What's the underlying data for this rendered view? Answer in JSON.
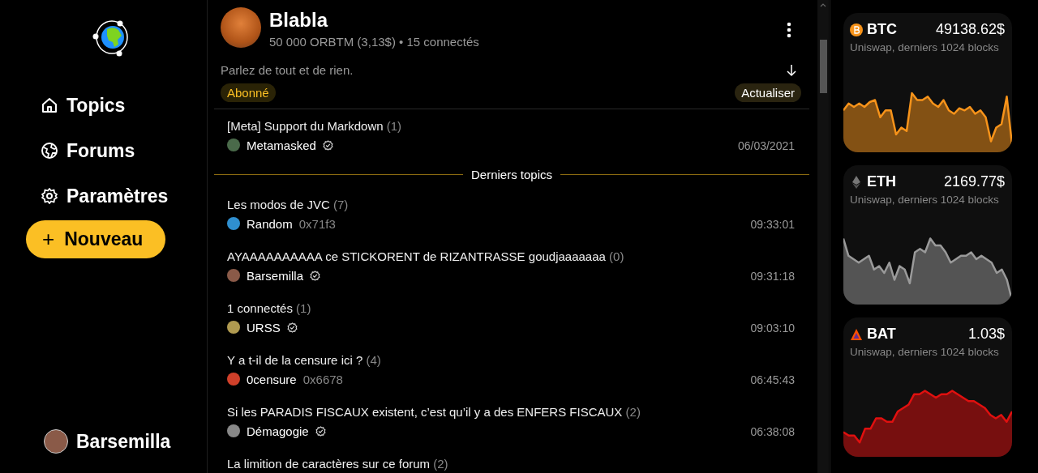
{
  "sidebar": {
    "nav": [
      {
        "label": "Topics"
      },
      {
        "label": "Forums"
      },
      {
        "label": "Paramètres"
      }
    ],
    "new_button_icon": "+",
    "new_button": "Nouveau",
    "user": {
      "name": "Barsemilla"
    }
  },
  "forum": {
    "name": "Blabla",
    "stats": "50 000 ORBTM (3,13$) • 15 connectés",
    "description": "Parlez de tout et de rien.",
    "subscribed_label": "Abonné",
    "refresh_label": "Actualiser"
  },
  "pinned": [
    {
      "title": "[Meta] Support du Markdown",
      "count": "(1)",
      "author": "Metamasked",
      "verified": true,
      "time": "06/03/2021"
    }
  ],
  "section_title": "Derniers topics",
  "topics": [
    {
      "title": "Les modos de JVC",
      "count": "(7)",
      "author": "Random",
      "address": "0x71f3",
      "verified": false,
      "time": "09:33:01"
    },
    {
      "title": " AYAAAAAAAAAA ce STICKORENT de RIZANTRASSE goudjaaaaaaa",
      "count": "(0)",
      "author": "Barsemilla",
      "verified": true,
      "time": "09:31:18"
    },
    {
      "title": "1 connectés",
      "count": "(1)",
      "author": "URSS",
      "verified": true,
      "time": "09:03:10"
    },
    {
      "title": "Y a t-il de la censure ici ?",
      "count": "(4)",
      "author": "0censure",
      "address": "0x6678",
      "verified": false,
      "time": "06:45:43"
    },
    {
      "title": "Si les PARADIS FISCAUX existent, c’est qu’il y a des ENFERS FISCAUX",
      "count": "(2)",
      "author": "Démagogie",
      "verified": true,
      "time": "06:38:08"
    },
    {
      "title": "La limition de caractères sur ce forum",
      "count": "(2)"
    }
  ],
  "coins": [
    {
      "symbol": "BTC",
      "price": "49138.62$",
      "source": "Uniswap, derniers 1024 blocks",
      "color": "#f7931a"
    },
    {
      "symbol": "ETH",
      "price": "2169.77$",
      "source": "Uniswap, derniers 1024 blocks",
      "color": "#9a9a9a"
    },
    {
      "symbol": "BAT",
      "price": "1.03$",
      "source": "Uniswap, derniers 1024 blocks",
      "color": "#e0100f"
    }
  ]
}
